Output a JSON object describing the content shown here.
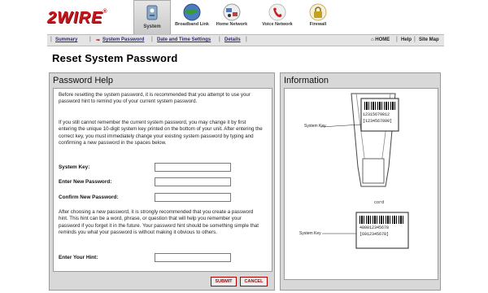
{
  "brand": {
    "logo_text": "2WIRE",
    "reg_mark": "®"
  },
  "nav": {
    "tabs": [
      {
        "label": "System",
        "icon": "system-icon",
        "color": "#8aa8c8"
      },
      {
        "label": "Broadband Link",
        "icon": "globe-icon",
        "color": "#4a7cc0"
      },
      {
        "label": "Home Network",
        "icon": "home-network-icon",
        "color": "#c04040"
      },
      {
        "label": "Voice Network",
        "icon": "phone-icon",
        "color": "#c82020"
      },
      {
        "label": "Firewall",
        "icon": "lock-icon",
        "color": "#c8a020"
      }
    ]
  },
  "subnav": {
    "links": [
      "Summary",
      "System Password",
      "Date and Time Settings",
      "Details"
    ],
    "right": {
      "home": "HOME",
      "help": "Help",
      "site_map": "Site Map"
    }
  },
  "page": {
    "title": "Reset System Password"
  },
  "help_panel": {
    "title": "Password Help",
    "intro": "Before resetting the system password, it is recommended that you attempt to use your password hint to remind you of your current system password.",
    "instructions": "If you still cannot remember the current system password, you may change it by first entering the unique 10-digit system key printed on the bottom of your unit. After entering the correct key, you must immediately change your existing system password by typing and confirming a new password in the spaces below.",
    "fields": {
      "system_key": {
        "label": "System Key:",
        "value": ""
      },
      "new_password": {
        "label": "Enter New Password:",
        "value": ""
      },
      "confirm_password": {
        "label": "Confirm New Password:",
        "value": ""
      },
      "hint": {
        "label": "Enter Your Hint:",
        "value": ""
      }
    },
    "hint_text": "After choosing a new password, it is strongly recommended that you create a password hint. This hint can be a word, phrase, or question that will help you remember your password if you forget it in the future. Your password hint should be something simple that reminds you what your password is without making it obvious to others.",
    "buttons": {
      "submit": "SUBMIT",
      "cancel": "CANCEL"
    }
  },
  "info_panel": {
    "title": "Information",
    "label_top": "System Key",
    "label_bottom": "System Key",
    "serial_top": "12315679812",
    "key_top": "[1234567890]",
    "serial_bottom": "480012345678",
    "key_bottom": "[6912345678]",
    "small_text": "cord"
  },
  "colors": {
    "brand_red": "#c8161d",
    "panel_gray": "#d8d8d8",
    "link_blue": "#2a2a7a"
  }
}
